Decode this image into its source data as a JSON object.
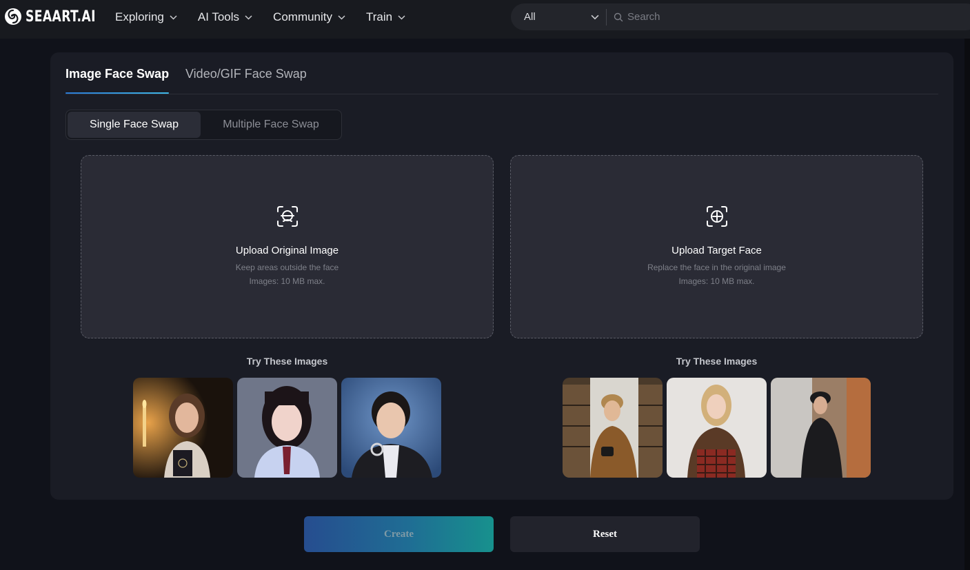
{
  "brand": {
    "name": "SEAART.AI"
  },
  "nav": {
    "items": [
      {
        "label": "Exploring"
      },
      {
        "label": "AI Tools"
      },
      {
        "label": "Community"
      },
      {
        "label": "Train"
      }
    ]
  },
  "search": {
    "scope": "All",
    "placeholder": "Search"
  },
  "tabs": {
    "image": "Image Face Swap",
    "video": "Video/GIF Face Swap",
    "active": "Image Face Swap"
  },
  "mode": {
    "single": "Single Face Swap",
    "multiple": "Multiple Face Swap",
    "active": "Single Face Swap"
  },
  "upload_original": {
    "title": "Upload Original Image",
    "subtitle": "Keep areas outside the face",
    "limit": "Images: 10 MB max."
  },
  "upload_target": {
    "title": "Upload Target Face",
    "subtitle": "Replace the face in the original image",
    "limit": "Images: 10 MB max."
  },
  "samples": {
    "label": "Try These Images"
  },
  "actions": {
    "create": "Create",
    "reset": "Reset"
  },
  "colors": {
    "background": "#10121a",
    "panel": "#1a1c25",
    "dropzone": "#2a2b35",
    "accent_gradient_start": "#264d8f",
    "accent_gradient_end": "#17918d"
  },
  "icons": {
    "logo": "seaart-swirl-logo",
    "dropdown": "chevron-down-icon",
    "search": "search-icon",
    "upload_original": "face-scan-icon",
    "upload_target": "face-target-plus-icon"
  }
}
